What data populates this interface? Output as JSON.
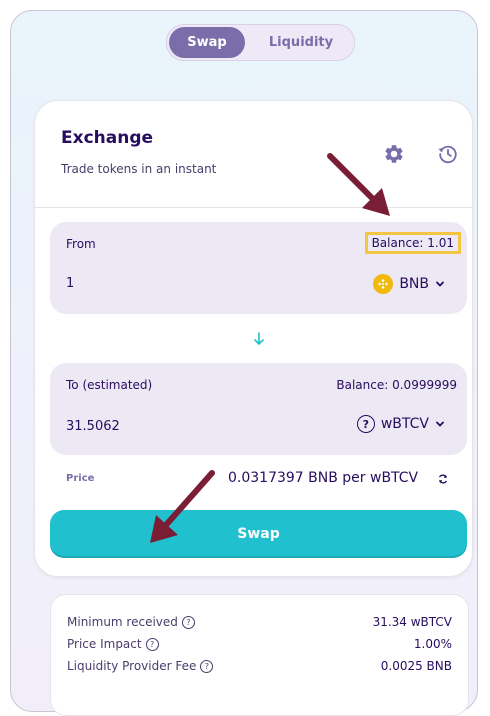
{
  "tabs": {
    "swap": "Swap",
    "liquidity": "Liquidity"
  },
  "header": {
    "title": "Exchange",
    "subtitle": "Trade tokens in an instant"
  },
  "from": {
    "label": "From",
    "balance": "Balance: 1.01",
    "value": "1",
    "token": "BNB"
  },
  "to": {
    "label": "To (estimated)",
    "balance": "Balance: 0.0999999",
    "value": "31.5062",
    "token": "wBTCV"
  },
  "price": {
    "label": "Price",
    "value": "0.0317397 BNB per wBTCV"
  },
  "swap_button": "Swap",
  "info": {
    "min_received": {
      "label": "Minimum received",
      "value": "31.34 wBTCV"
    },
    "price_impact": {
      "label": "Price Impact",
      "value": "1.00%"
    },
    "lp_fee": {
      "label": "Liquidity Provider Fee",
      "value": "0.0025 BNB"
    }
  },
  "colors": {
    "accent": "#7a6eaa",
    "button": "#20c0cf",
    "highlight": "#f4c542",
    "arrow": "#7a1e35",
    "bnb": "#f0b90b"
  },
  "icons": [
    "gear-icon",
    "history-icon",
    "bnb-logo-icon",
    "chevron-down-icon",
    "arrow-down-icon",
    "question-circle-icon",
    "refresh-icon",
    "help-icon"
  ]
}
